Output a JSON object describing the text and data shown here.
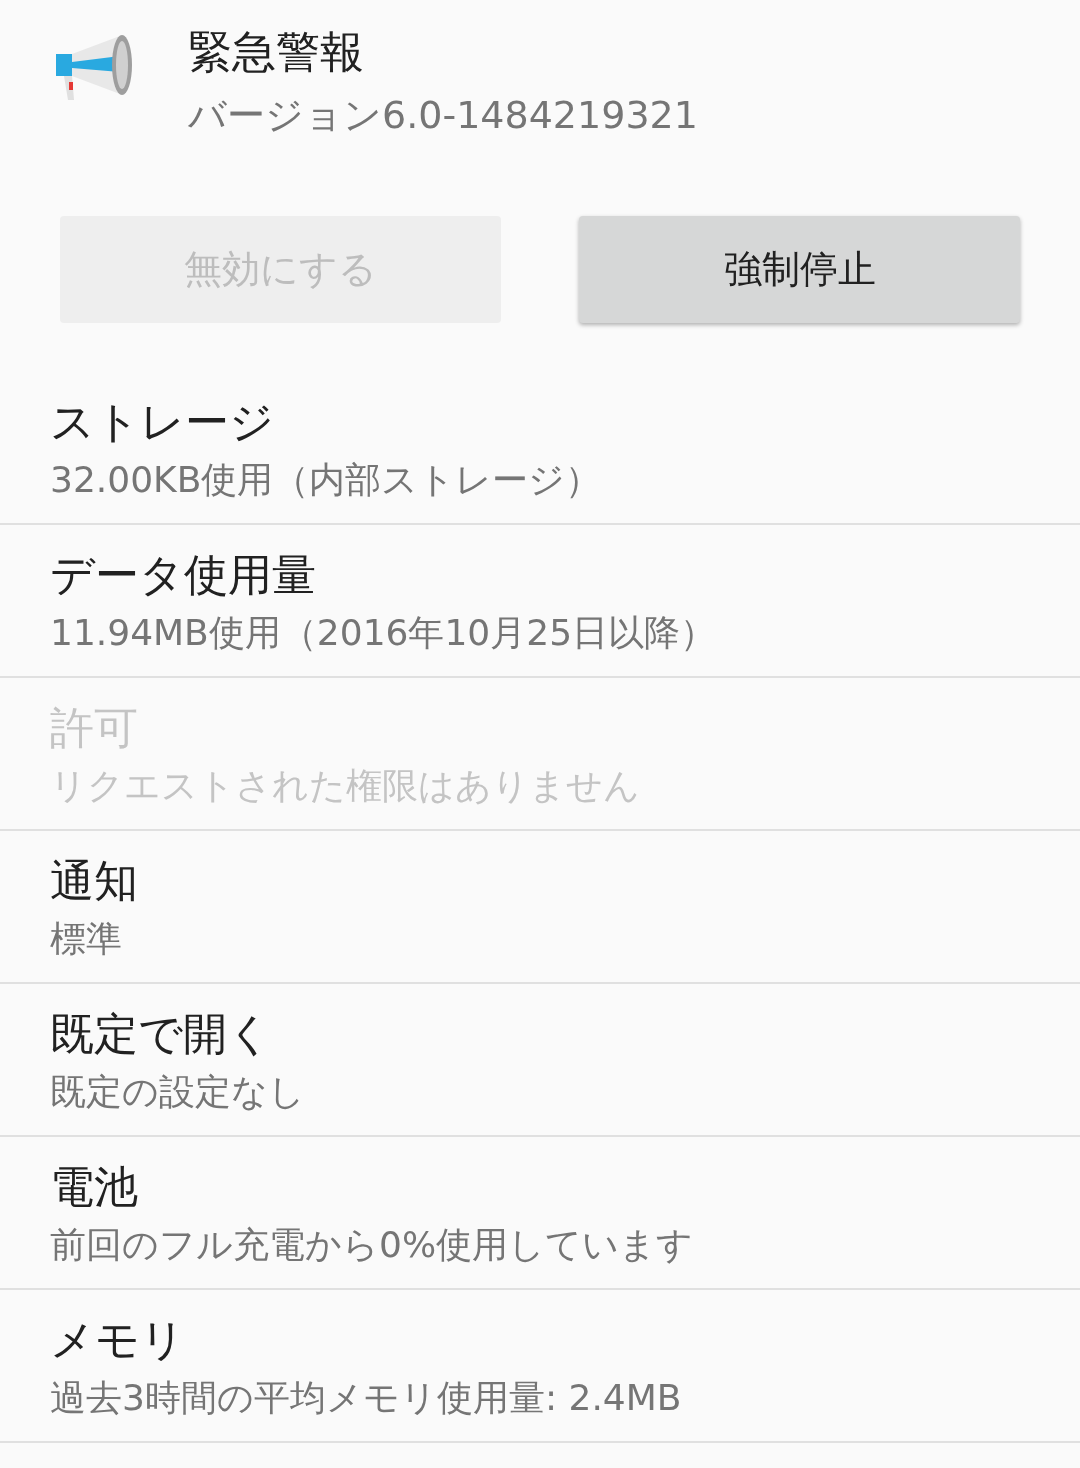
{
  "app": {
    "name": "緊急警報",
    "version": "バージョン6.0-1484219321"
  },
  "buttons": [
    {
      "label": "無効にする",
      "disabled": true
    },
    {
      "label": "強制停止",
      "disabled": false
    }
  ],
  "items": [
    {
      "title": "ストレージ",
      "subtitle": "32.00KB使用（内部ストレージ）",
      "disabled": false
    },
    {
      "title": "データ使用量",
      "subtitle": "11.94MB使用（2016年10月25日以降）",
      "disabled": false
    },
    {
      "title": "許可",
      "subtitle": "リクエストされた権限はありません",
      "disabled": true
    },
    {
      "title": "通知",
      "subtitle": "標準",
      "disabled": false
    },
    {
      "title": "既定で開く",
      "subtitle": "既定の設定なし",
      "disabled": false
    },
    {
      "title": "電池",
      "subtitle": "前回のフル充電から0%使用しています",
      "disabled": false
    },
    {
      "title": "メモリ",
      "subtitle": "過去3時間の平均メモリ使用量: 2.4MB",
      "disabled": false
    }
  ]
}
